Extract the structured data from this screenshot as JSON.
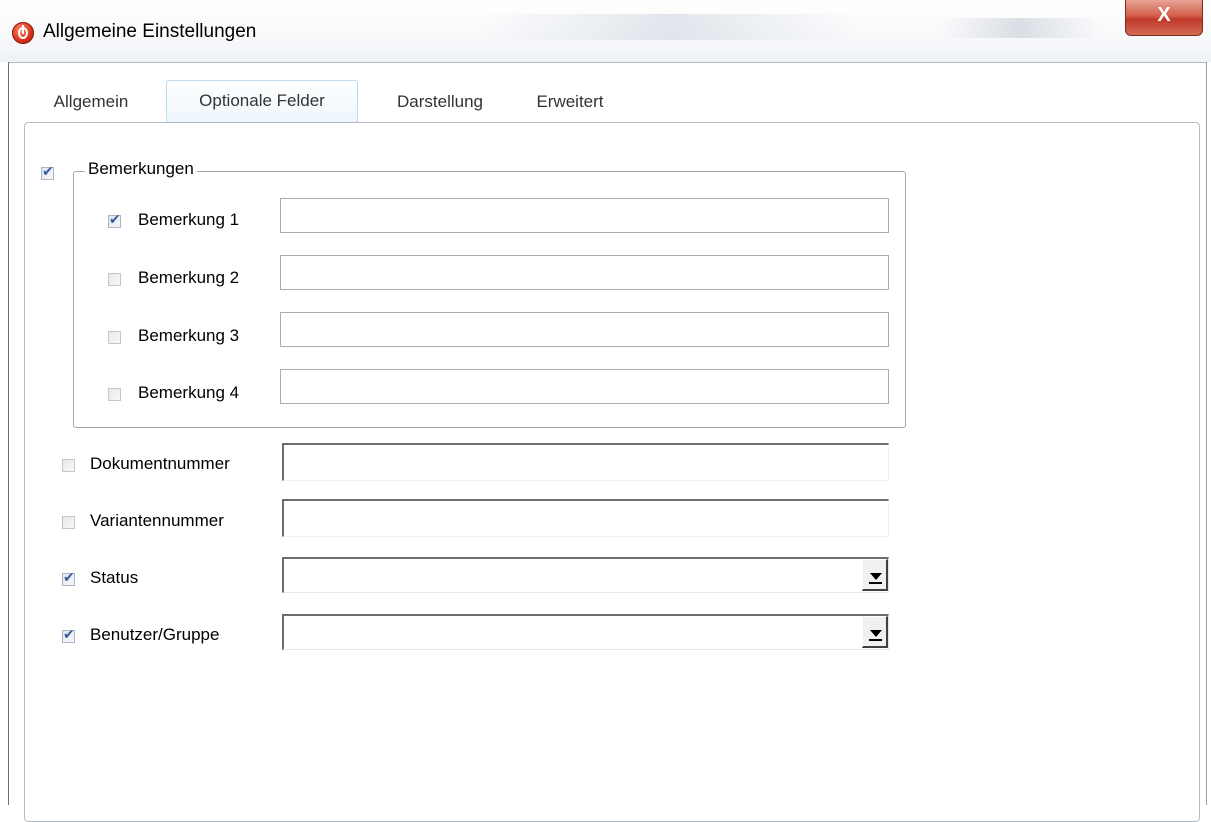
{
  "window": {
    "title": "Allgemeine Einstellungen",
    "close_label": "X",
    "icon": "app-logo-icon"
  },
  "tabs": [
    {
      "label": "Allgemein",
      "active": false
    },
    {
      "label": "Optionale Felder",
      "active": true
    },
    {
      "label": "Darstellung",
      "active": false
    },
    {
      "label": "Erweitert",
      "active": false
    }
  ],
  "bemerkungen_group": {
    "label": "Bemerkungen",
    "checked": true,
    "items": [
      {
        "label": "Bemerkung 1",
        "checked": true,
        "value": ""
      },
      {
        "label": "Bemerkung 2",
        "checked": false,
        "value": ""
      },
      {
        "label": "Bemerkung 3",
        "checked": false,
        "value": ""
      },
      {
        "label": "Bemerkung 4",
        "checked": false,
        "value": ""
      }
    ]
  },
  "fields": [
    {
      "label": "Dokumentnummer",
      "checked": false,
      "type": "text",
      "value": ""
    },
    {
      "label": "Variantennummer",
      "checked": false,
      "type": "text",
      "value": ""
    },
    {
      "label": "Status",
      "checked": true,
      "type": "combo",
      "value": ""
    },
    {
      "label": "Benutzer/Gruppe",
      "checked": true,
      "type": "combo",
      "value": ""
    }
  ],
  "colors": {
    "close_button": "#c0392b",
    "checkmark": "#3a5a9a",
    "active_tab_border": "#b9d9ee"
  }
}
